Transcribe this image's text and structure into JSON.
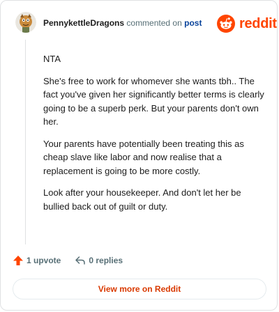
{
  "header": {
    "author": "PennykettleDragons",
    "action": "commented on",
    "post_link": "post",
    "logo_text": "reddit"
  },
  "comment": {
    "paragraphs": [
      "NTA",
      "She's free to work for whomever she wants tbh.. The fact you've given her significantly better terms is clearly going to be a superb perk. But your parents don't own her.",
      "Your parents have potentially been treating this as cheap slave like labor and now realise that a replacement is going to be more costly.",
      "Look after your housekeeper. And don't let her be bullied back out of guilt or duty."
    ]
  },
  "footer": {
    "upvotes": "1 upvote",
    "replies": "0 replies",
    "view_more": "View more on Reddit"
  },
  "colors": {
    "brand": "#ff4500",
    "link": "#0a449b",
    "view_more": "#d93900"
  },
  "icons": {
    "avatar": "dragon-avatar",
    "logo": "reddit-snoo-icon",
    "upvote": "upvote-arrow-icon",
    "reply": "reply-arrow-icon"
  }
}
